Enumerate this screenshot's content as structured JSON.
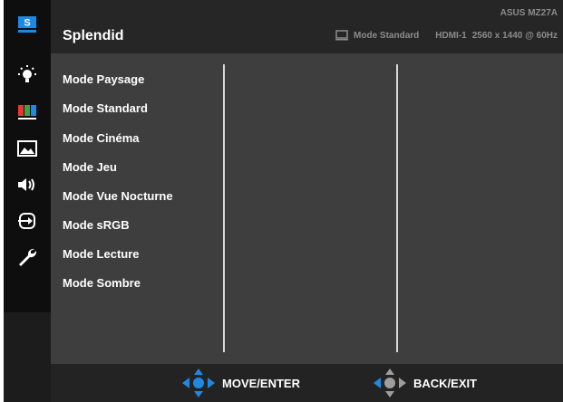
{
  "header": {
    "title": "Splendid",
    "model": "ASUS MZ27A",
    "current_mode": "Mode Standard",
    "input": "HDMI-1",
    "resolution": "2560 x 1440 @ 60Hz"
  },
  "sidebar": {
    "items": [
      {
        "icon": "splendid-icon",
        "active": true
      },
      {
        "icon": "brightness-icon"
      },
      {
        "icon": "color-icon"
      },
      {
        "icon": "image-icon"
      },
      {
        "icon": "sound-icon"
      },
      {
        "icon": "input-select-icon"
      },
      {
        "icon": "system-setup-icon"
      }
    ]
  },
  "menu": {
    "items": [
      "Mode Paysage",
      "Mode Standard",
      "Mode Cinéma",
      "Mode Jeu",
      "Mode Vue Nocturne",
      "Mode sRGB",
      "Mode Lecture",
      "Mode Sombre"
    ]
  },
  "footer": {
    "move_enter": "MOVE/ENTER",
    "back_exit": "BACK/EXIT"
  },
  "colors": {
    "accent": "#1e88e5",
    "panel": "#3e3e3e",
    "sidebar": "#0e0e0e"
  }
}
